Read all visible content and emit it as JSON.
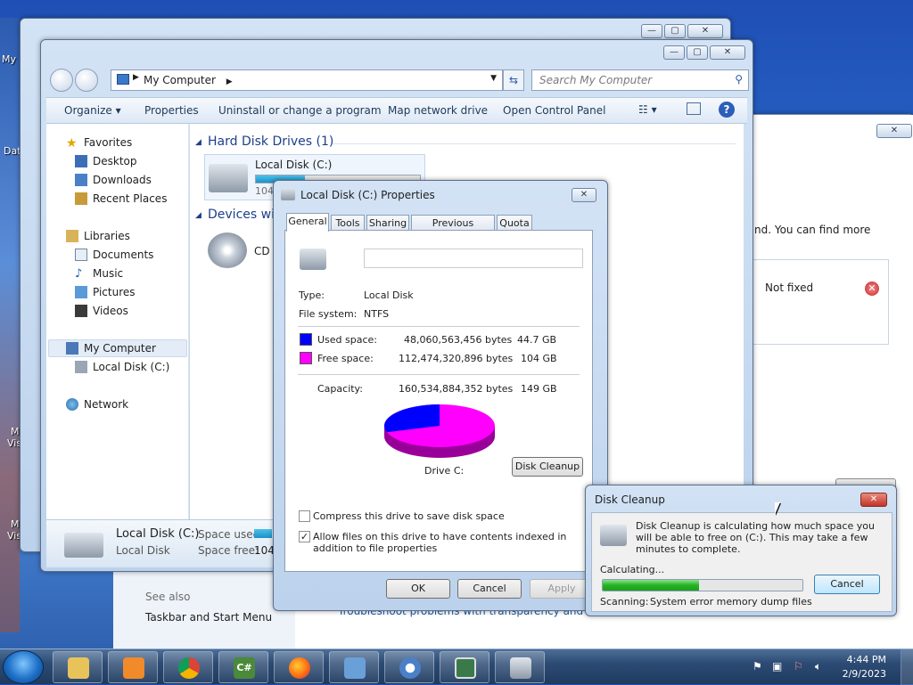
{
  "desktop": {
    "labels": [
      "My",
      "Dat",
      "M",
      "Vis",
      "M",
      "Vis"
    ]
  },
  "explorer": {
    "address": "My Computer",
    "search_placeholder": "Search My Computer",
    "toolbar": [
      "Organize",
      "Properties",
      "Uninstall or change a program",
      "Map network drive",
      "Open Control Panel"
    ],
    "nav": {
      "favorites": "Favorites",
      "desktop": "Desktop",
      "downloads": "Downloads",
      "recent": "Recent Places",
      "libraries": "Libraries",
      "documents": "Documents",
      "music": "Music",
      "pictures": "Pictures",
      "videos": "Videos",
      "my_computer": "My Computer",
      "local_disk": "Local Disk (C:)",
      "network": "Network"
    },
    "groups": {
      "hdd": "Hard Disk Drives (1)",
      "devices": "Devices wi"
    },
    "drive": {
      "name": "Local Disk (C:)",
      "size_fragment": "104",
      "usage_fraction": 0.3
    },
    "cd": "CD I",
    "status": {
      "name": "Local Disk (C:)",
      "type": "Local Disk",
      "used_label": "Space used:",
      "free_label": "Space free:",
      "free_fragment": "104"
    }
  },
  "control_panel": {
    "text_fragment": "nd. You can find more",
    "not_fixed": "Not fixed",
    "see_also": "See also",
    "taskbar_link": "Taskbar and Start Menu",
    "troubleshoot": "Troubleshoot problems with transparency and other"
  },
  "properties": {
    "title": "Local Disk (C:) Properties",
    "tabs": [
      "General",
      "Tools",
      "Sharing",
      "Previous Versions",
      "Quota"
    ],
    "type_label": "Type:",
    "type_value": "Local Disk",
    "fs_label": "File system:",
    "fs_value": "NTFS",
    "used_label": "Used space:",
    "used_bytes": "48,060,563,456 bytes",
    "used_gb": "44.7 GB",
    "free_label": "Free space:",
    "free_bytes": "112,474,320,896 bytes",
    "free_gb": "104 GB",
    "capacity_label": "Capacity:",
    "capacity_bytes": "160,534,884,352 bytes",
    "capacity_gb": "149 GB",
    "drive_label": "Drive C:",
    "disk_cleanup_btn": "Disk Cleanup",
    "compress_label": "Compress this drive to save disk space",
    "index_label": "Allow files on this drive to have contents indexed in addition to file properties",
    "ok": "OK",
    "cancel": "Cancel",
    "apply": "Apply",
    "used_color": "#0000ff",
    "free_color": "#ff00ff",
    "used_fraction": 0.299
  },
  "cleanup": {
    "title": "Disk Cleanup",
    "message": "Disk Cleanup is calculating how much space you will be able to free on  (C:). This may take a few minutes to complete.",
    "calculating": "Calculating...",
    "cancel": "Cancel",
    "scanning_label": "Scanning:",
    "scanning_value": "System error memory dump files",
    "progress": 0.48
  },
  "taskbar": {
    "time": "4:44 PM",
    "date": "2/9/2023"
  }
}
